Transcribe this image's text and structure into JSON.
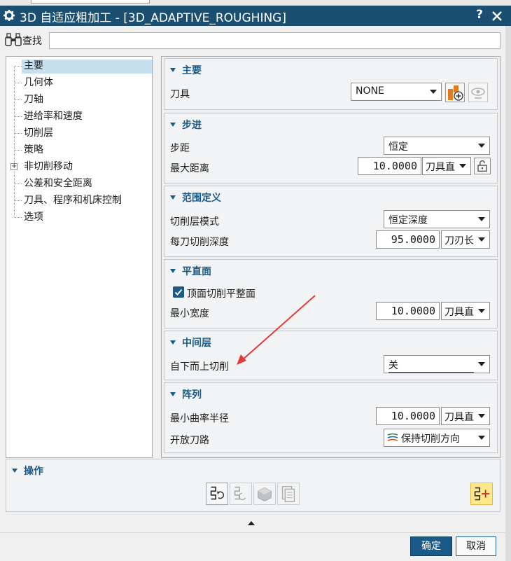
{
  "window": {
    "title": "3D 自适应粗加工 - [3D_ADAPTIVE_ROUGHING]",
    "help_label": "?"
  },
  "search": {
    "label": "查找",
    "value": "",
    "placeholder": ""
  },
  "tree": {
    "items": [
      {
        "label": "主要",
        "selected": true
      },
      {
        "label": "几何体"
      },
      {
        "label": "刀轴"
      },
      {
        "label": "进给率和速度"
      },
      {
        "label": "切削层"
      },
      {
        "label": "策略"
      },
      {
        "label": "非切削移动",
        "expander": "+"
      },
      {
        "label": "公差和安全距离"
      },
      {
        "label": "刀具、程序和机床控制"
      },
      {
        "label": "选项"
      }
    ]
  },
  "sections": {
    "main": {
      "title": "主要",
      "tool_label": "刀具",
      "tool_value": "NONE"
    },
    "stepover": {
      "title": "步进",
      "step_label": "步距",
      "step_value": "恒定",
      "maxdist_label": "最大距离",
      "maxdist_value": "10.0000",
      "maxdist_unit": "刀具直"
    },
    "range": {
      "title": "范围定义",
      "mode_label": "切削层模式",
      "mode_value": "恒定深度",
      "depth_label": "每刀切削深度",
      "depth_value": "95.0000",
      "depth_unit": "刀刃长"
    },
    "flat": {
      "title": "平直面",
      "check_label": "顶面切削平整面",
      "checked": true,
      "minwidth_label": "最小宽度",
      "minwidth_value": "10.0000",
      "minwidth_unit": "刀具直"
    },
    "intermediate": {
      "title": "中间层",
      "bottomup_label": "自下而上切削",
      "bottomup_value": "关"
    },
    "pattern": {
      "title": "阵列",
      "minradius_label": "最小曲率半径",
      "minradius_value": "10.0000",
      "minradius_unit": "刀具直",
      "openpath_label": "开放刀路",
      "openpath_value": "保持切削方向"
    }
  },
  "operations": {
    "title": "操作"
  },
  "buttons": {
    "ok": "确定",
    "cancel": "取消"
  },
  "colors": {
    "titlebar": "#1a4f71",
    "accent": "#1a5a86",
    "selection": "#c7e0f0",
    "highlight": "#ffe88a",
    "annotation": "#e53935"
  }
}
